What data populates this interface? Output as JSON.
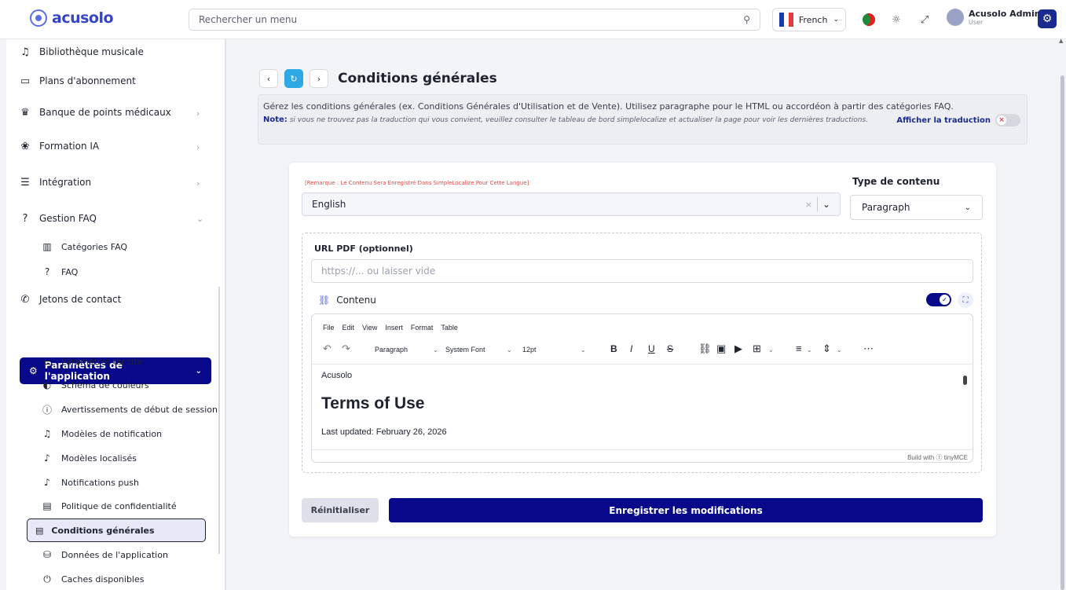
{
  "header": {
    "logo": "acusolo",
    "search_placeholder": "Rechercher un menu",
    "language": "French",
    "user_name": "Acusolo Admin",
    "user_role": "User"
  },
  "sidebar": {
    "items": [
      {
        "label": "Bibliothèque musicale",
        "icon": "music-icon"
      },
      {
        "label": "Plans d'abonnement",
        "icon": "ticket-icon"
      },
      {
        "label": "Banque de points médicaux",
        "icon": "trophy-icon"
      },
      {
        "label": "Formation IA",
        "icon": "brain-icon"
      },
      {
        "label": "Intégration",
        "icon": "sliders-icon"
      },
      {
        "label": "Gestion FAQ",
        "icon": "help-icon"
      },
      {
        "label": "Catégories FAQ",
        "icon": "grid-icon"
      },
      {
        "label": "FAQ",
        "icon": "help-icon"
      },
      {
        "label": "Jetons de contact",
        "icon": "phone-icon"
      },
      {
        "label": "Paramètres de l'application",
        "icon": "gear-icon"
      },
      {
        "label": "Paramètres du site",
        "icon": "toggle-icon"
      },
      {
        "label": "Schéma de couleurs",
        "icon": "palette-icon"
      },
      {
        "label": "Avertissements de début de session",
        "icon": "alert-icon"
      },
      {
        "label": "Modèles de notification",
        "icon": "bell-icon"
      },
      {
        "label": "Modèles localisés",
        "icon": "bell-dot-icon"
      },
      {
        "label": "Notifications push",
        "icon": "bell-dot-icon"
      },
      {
        "label": "Politique de confidentialité",
        "icon": "document-icon"
      },
      {
        "label": "Conditions générales",
        "icon": "document-icon"
      },
      {
        "label": "Données de l'application",
        "icon": "database-icon"
      },
      {
        "label": "Caches disponibles",
        "icon": "power-icon"
      }
    ]
  },
  "page": {
    "title": "Conditions générales",
    "description": "Gérez les conditions générales (ex. Conditions Générales d'Utilisation et de Vente). Utilisez paragraphe pour le HTML ou accordéon à partir des catégories FAQ.",
    "note_label": "Note:",
    "note_text": "si vous ne trouvez pas la traduction qui vous convient, veuillez consulter le tableau de bord simplelocalize et actualiser la page pour voir les dernières traductions.",
    "show_translation": "Afficher la traduction"
  },
  "form": {
    "remark": "[Remarque : Le Contenu Sera Enregistré Dans SimpleLocalize Pour Cette Langue]",
    "content_type_label": "Type de contenu",
    "language_value": "English",
    "content_type_value": "Paragraph",
    "pdf_label": "URL PDF (optionnel)",
    "pdf_placeholder": "https://... ou laisser vide",
    "content_label": "Contenu",
    "reset_label": "Réinitialiser",
    "save_label": "Enregistrer les modifications"
  },
  "editor": {
    "menu": [
      "File",
      "Edit",
      "View",
      "Insert",
      "Format",
      "Table"
    ],
    "block_format": "Paragraph",
    "font_family": "System Font",
    "font_size": "12pt",
    "body_p1": "Acusolo",
    "body_h1": "Terms of Use",
    "body_p2": "Last updated: February 26, 2026",
    "footer": "Build with ⓣ tinyMCE"
  }
}
